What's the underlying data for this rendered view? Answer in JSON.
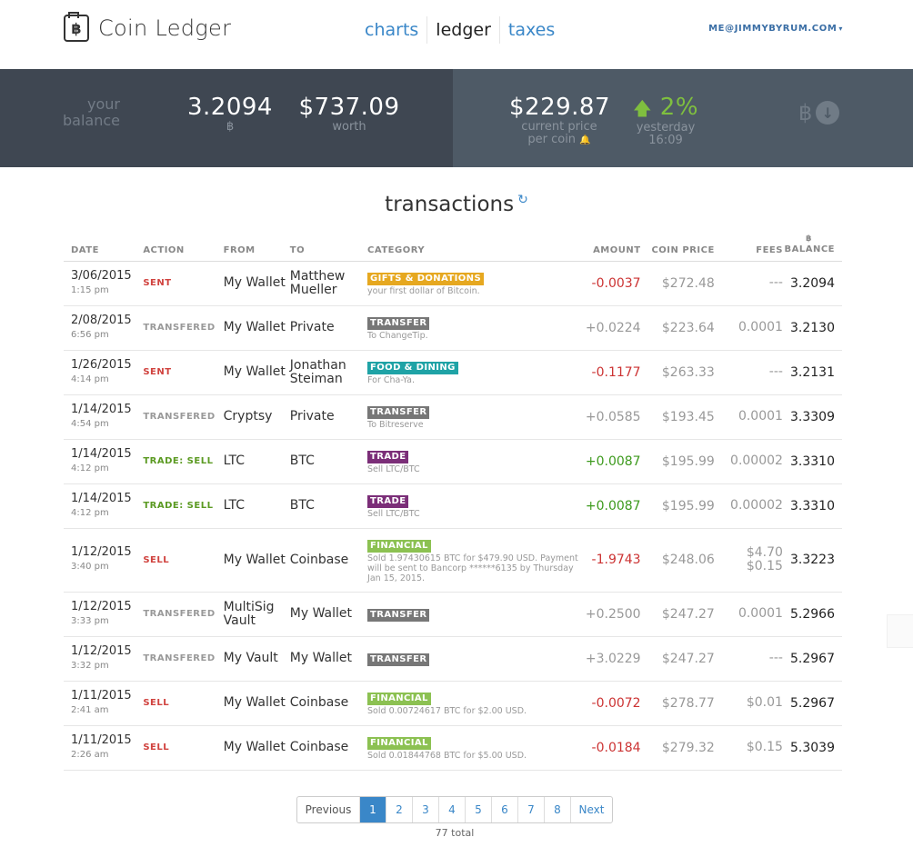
{
  "app": {
    "title": "Coin Ledger",
    "logo_symbol": "฿"
  },
  "nav": {
    "items": [
      {
        "label": "charts",
        "active": false
      },
      {
        "label": "ledger",
        "active": true
      },
      {
        "label": "taxes",
        "active": false
      }
    ],
    "user": "ME@JIMMYBYRUM.COM",
    "user_caret": "▾"
  },
  "banner": {
    "your_balance_label": "your balance",
    "balance_btc": "3.2094",
    "btc_symbol": "฿",
    "worth_value": "$737.09",
    "worth_label": "worth",
    "price_value": "$229.87",
    "price_label_line1": "current price",
    "price_label_line2": "per coin",
    "bell_icon": "🔔",
    "change_arrow": "🡅",
    "change_value": "2%",
    "change_label": "yesterday",
    "change_time": "16:09",
    "colors": {
      "left_bg": "#3f4752",
      "right_bg": "#4e5a66",
      "change": "#7fbf3f"
    }
  },
  "transactions": {
    "title": "transactions",
    "refresh_icon": "↻",
    "columns": {
      "date": "DATE",
      "action": "ACTION",
      "from": "FROM",
      "to": "TO",
      "category": "CATEGORY",
      "amount": "AMOUNT",
      "coin_price": "COIN PRICE",
      "fees": "FEES",
      "balance_symbol": "฿",
      "balance": "BALANCE"
    },
    "rows": [
      {
        "date": "3/06/2015",
        "time": "1:15 pm",
        "action": "SENT",
        "action_type": "sent",
        "from": "My Wallet",
        "to": "Matthew Mueller",
        "tag": "GIFTS & DONATIONS",
        "tag_type": "gifts",
        "note": "your first dollar of Bitcoin.",
        "amount": "-0.0037",
        "amount_type": "neg",
        "price": "$272.48",
        "fees": "---",
        "balance": "3.2094"
      },
      {
        "date": "2/08/2015",
        "time": "6:56 pm",
        "action": "TRANSFERED",
        "action_type": "transfer",
        "from": "My Wallet",
        "to": "Private",
        "tag": "TRANSFER",
        "tag_type": "transfer",
        "note": "To ChangeTip.",
        "amount": "+0.0224",
        "amount_type": "gray",
        "price": "$223.64",
        "fees": "0.0001",
        "balance": "3.2130"
      },
      {
        "date": "1/26/2015",
        "time": "4:14 pm",
        "action": "SENT",
        "action_type": "sent",
        "from": "My Wallet",
        "to": "Jonathan Steiman",
        "tag": "FOOD & DINING",
        "tag_type": "food",
        "note": "For Cha-Ya.",
        "amount": "-0.1177",
        "amount_type": "neg",
        "price": "$263.33",
        "fees": "---",
        "balance": "3.2131"
      },
      {
        "date": "1/14/2015",
        "time": "4:54 pm",
        "action": "TRANSFERED",
        "action_type": "transfer",
        "from": "Cryptsy",
        "to": "Private",
        "tag": "TRANSFER",
        "tag_type": "transfer",
        "note": "To Bitreserve",
        "amount": "+0.0585",
        "amount_type": "gray",
        "price": "$193.45",
        "fees": "0.0001",
        "balance": "3.3309"
      },
      {
        "date": "1/14/2015",
        "time": "4:12 pm",
        "action": "TRADE: SELL",
        "action_type": "trade",
        "from": "LTC",
        "to": "BTC",
        "tag": "TRADE",
        "tag_type": "trade",
        "note": "Sell LTC/BTC",
        "amount": "+0.0087",
        "amount_type": "green",
        "price": "$195.99",
        "fees": "0.00002",
        "balance": "3.3310"
      },
      {
        "date": "1/14/2015",
        "time": "4:12 pm",
        "action": "TRADE: SELL",
        "action_type": "trade",
        "from": "LTC",
        "to": "BTC",
        "tag": "TRADE",
        "tag_type": "trade",
        "note": "Sell LTC/BTC",
        "amount": "+0.0087",
        "amount_type": "green",
        "price": "$195.99",
        "fees": "0.00002",
        "balance": "3.3310"
      },
      {
        "date": "1/12/2015",
        "time": "3:40 pm",
        "action": "SELL",
        "action_type": "sent",
        "from": "My Wallet",
        "to": "Coinbase",
        "tag": "FINANCIAL",
        "tag_type": "financial",
        "note": "Sold 1.97430615 BTC for $479.90 USD. Payment will be sent to Bancorp ******6135 by Thursday Jan 15, 2015.",
        "amount": "-1.9743",
        "amount_type": "neg",
        "price": "$248.06",
        "fees": "$4.70 $0.15",
        "balance": "3.3223"
      },
      {
        "date": "1/12/2015",
        "time": "3:33 pm",
        "action": "TRANSFERED",
        "action_type": "transfer",
        "from": "MultiSig Vault",
        "to": "My Wallet",
        "tag": "TRANSFER",
        "tag_type": "transfer",
        "note": "",
        "amount": "+0.2500",
        "amount_type": "gray",
        "price": "$247.27",
        "fees": "0.0001",
        "balance": "5.2966"
      },
      {
        "date": "1/12/2015",
        "time": "3:32 pm",
        "action": "TRANSFERED",
        "action_type": "transfer",
        "from": "My Vault",
        "to": "My Wallet",
        "tag": "TRANSFER",
        "tag_type": "transfer",
        "note": "",
        "amount": "+3.0229",
        "amount_type": "gray",
        "price": "$247.27",
        "fees": "---",
        "balance": "5.2967"
      },
      {
        "date": "1/11/2015",
        "time": "2:41 am",
        "action": "SELL",
        "action_type": "sent",
        "from": "My Wallet",
        "to": "Coinbase",
        "tag": "FINANCIAL",
        "tag_type": "financial",
        "note": "Sold 0.00724617 BTC for $2.00 USD.",
        "amount": "-0.0072",
        "amount_type": "neg",
        "price": "$278.77",
        "fees": "$0.01",
        "balance": "5.2967"
      },
      {
        "date": "1/11/2015",
        "time": "2:26 am",
        "action": "SELL",
        "action_type": "sent",
        "from": "My Wallet",
        "to": "Coinbase",
        "tag": "FINANCIAL",
        "tag_type": "financial",
        "note": "Sold 0.01844768 BTC for $5.00 USD.",
        "amount": "-0.0184",
        "amount_type": "neg",
        "price": "$279.32",
        "fees": "$0.15",
        "balance": "5.3039"
      }
    ]
  },
  "pagination": {
    "previous": "Previous",
    "pages": [
      "1",
      "2",
      "3",
      "4",
      "5",
      "6",
      "7",
      "8"
    ],
    "active_page": "1",
    "next": "Next",
    "total": "77 total"
  }
}
